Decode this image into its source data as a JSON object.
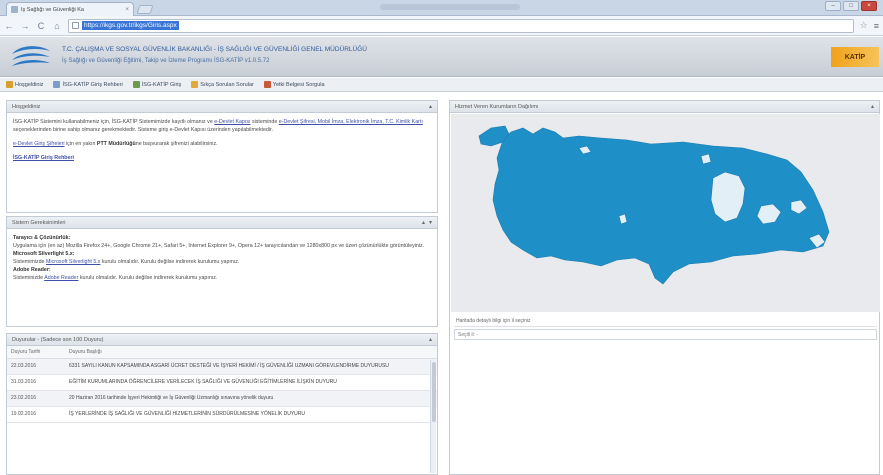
{
  "browser": {
    "tab_title": "İş Sağlığı ve Güvenliği Ka",
    "tab_close": "×",
    "url": "https://ikgs.gov.tr/ikgs/Giris.aspx",
    "back": "←",
    "forward": "→",
    "reload": "C",
    "home": "⌂",
    "star": "☆",
    "wrench": "≡",
    "win_min": "–",
    "win_max": "□",
    "win_close": "×"
  },
  "header": {
    "line1": "T.C. ÇALIŞMA VE SOSYAL GÜVENLİK BAKANLIĞI - İŞ SAĞLIĞI VE GÜVENLİĞİ GENEL MÜDÜRLÜĞÜ",
    "line2": "İş Sağlığı ve Güvenliği Eğitimi, Takip ve İzleme Programı İSG-KATİP v1.0.5.72",
    "brand": "KATİP"
  },
  "menu": [
    {
      "label": "Hoşgeldiniz",
      "color": "#d9a02a"
    },
    {
      "label": "İSG-KATİP Giriş Rehberi",
      "color": "#7a9ec8"
    },
    {
      "label": "İSG-KATİP Giriş",
      "color": "#6a9a4a"
    },
    {
      "label": "Sıkça Sorulan Sorular",
      "color": "#e0a93a"
    },
    {
      "label": "Yetki Belgesi Sorgula",
      "color": "#c85a3a"
    }
  ],
  "welcome": {
    "title": "Hoşgeldiniz",
    "p1_a": "İSG-KATİP Sistemini kullanabilmeniz için, İSG-KATİP Sistemimizde kayıtlı olmanız ve ",
    "p1_link1": "e-Devlet Kapısı",
    "p1_b": " sisteminde ",
    "p1_link2": "e-Devlet Şifresi, Mobil İmza, Elektronik İmza, T.C. Kimlik Kartı",
    "p1_c": " seçeneklerinden birine sahip olmanız gerekmektedir. Sisteme giriş e-Devlet Kapısı üzerinden yapılabilmektedir.",
    "p2_link": "e-Devlet Giriş Şifreleri",
    "p2_a": " için en yakın ",
    "p2_bold": "PTT Müdürlüğü",
    "p2_b": "ne başvurarak şifrenizi alabilirsiniz.",
    "p3_link": "İSG-KATİP Giriş Rehberi"
  },
  "requirements": {
    "title": "Sistem Gereksinimleri",
    "h1": "Tarayıcı & Çözünürlük:",
    "t1": "Uygulama için (en az) Mozilla Firefox 24+, Google Chrome 21+, Safari 5+, Internet Explorer 9+, Opera 12+ tarayıcılarıdan ve 1280x800 px ve üzeri çözünürlükte görüntüleyiniz.",
    "h2": "Microsoft Silverlight 5.x:",
    "t2_a": "Sistemimizde ",
    "t2_link": "Microsoft Silverlight 5.x",
    "t2_b": " kurulu olmalıdır. Kurulu değilse indirerek kurulumu yapınız.",
    "h3": "Adobe Reader:",
    "t3_a": "Sisteminizde ",
    "t3_link": "Adobe Reader",
    "t3_b": " kurulu olmalıdır. Kurulu değilse indirerek kurulumu yapınız."
  },
  "announcements": {
    "title": "Duyurular - (Sadece son 100 Duyuru)",
    "col_date": "Duyuru Tarihi",
    "col_subject": "Duyuru Başlığı",
    "rows": [
      {
        "date": "22.03.2016",
        "text": "6331 SAYILI KANUN KAPSAMINDA ASGARİ ÜCRET DESTEĞİ VE İŞYERİ HEKİMİ / İŞ GÜVENLİĞİ UZMANI GÖREVLENDİRME DUYURUSU"
      },
      {
        "date": "31.03.2016",
        "text": "EĞİTİM KURUMLARINDA ÖĞRENCİLERE VERİLECEK İŞ SAĞLIĞI VE GÜVENLİĞİ EĞİTİMLERİNE İLİŞKİN DUYURU"
      },
      {
        "date": "23.02.2016",
        "text": "20 Haziran 2016 tarihinde İşyeri Hekimliği ve İş Güvenliği Uzmanlığı sınavına yönelik duyuru"
      },
      {
        "date": "19.02.2016",
        "text": "İŞ YERLERİNDE İŞ SAĞLIĞI VE GÜVENLİĞİ HİZMETLERİNİN SÜRDÜRÜLMESİNE YÖNELİK DUYURU"
      }
    ]
  },
  "map_panel": {
    "title": "Hizmet Veren Kurumların Dağılımı",
    "status": "Haritada detaylı bilgi için il seçiniz",
    "field": "Seçili il: -"
  },
  "colors": {
    "map_fill": "#1f8fc8",
    "map_highlight": "#e3eff7",
    "link": "#3f4fa8"
  }
}
